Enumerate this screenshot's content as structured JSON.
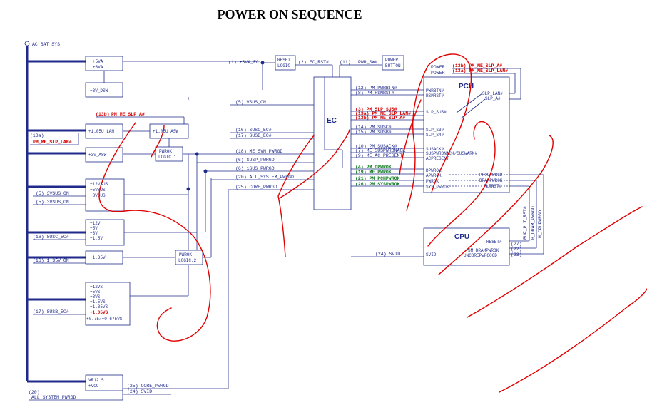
{
  "title": "POWER ON SEQUENCE",
  "rail": "AC_BAT_SYS",
  "left_blocks": {
    "b1": [
      "+5VA",
      "+3VA"
    ],
    "b1b": "+3V_DSW",
    "b2": "+1.05U_LAN",
    "b3": "+1.05U_ASW",
    "b4": "+3V_ASW",
    "pwrok1": [
      "PWROK",
      "LOGIC.1"
    ],
    "b5": [
      "+12VSUS",
      "+5VSUS",
      "+3VSUS"
    ],
    "b6": [
      "+12V",
      "+5V",
      "+3V",
      "+1.5V"
    ],
    "b7": "+1.35V",
    "pwrok2": [
      "PWROK",
      "LOGIC.2"
    ],
    "b8": [
      "+12VS",
      "+5VS",
      "+3VS",
      "+1.5VS",
      "+1.35VS"
    ],
    "b8_red": "+1.05VS",
    "b8_last": "+0.75/+0.675VS",
    "vr": [
      "VR12.5",
      "+VCC"
    ]
  },
  "left_signals": {
    "s13b": "(13b)",
    "s13b_name": "PM_ME_SLP_A#",
    "s13a": "(13a)",
    "s13a_name": "PM_ME_SLP_LAN#",
    "s5a": "(5) 3VSUS_ON",
    "s5b": "(5) 3VSUS_ON",
    "s16a": "(16) SUSC_EC#",
    "s16b": "(16) 1.35V_ON",
    "s17": "(17) SUSB_EC#",
    "s20": "(20)",
    "s20_name": "ALL_SYSTEM_PWRGD",
    "s25": "(25) CORE_PWRGD",
    "s24": "(24) SVID"
  },
  "top": {
    "s1": "(1) +3VA_EC",
    "reset": [
      "RESET",
      "LOGIC"
    ],
    "s2": "(2) EC_RST#",
    "s11": "(11)",
    "pwr_sw": "PWR_SW#",
    "button": [
      "POWER",
      "BUTTON"
    ]
  },
  "ec": {
    "title": "EC",
    "left_signals": [
      "(5) VSUS_ON",
      "(16) SUSC_EC#",
      "(17) SUSB_EC#",
      "(18) ME_SVM_PWRGD",
      "(6) SUSP_PWRGD",
      "(6) 1SUS_PWRGD",
      "(20) ALL_SYSTEM_PWRGD",
      "(25) CORE_PWRGD"
    ]
  },
  "ec_pch": [
    {
      "text": "(12) PM_PWRBTN#",
      "color": "blue"
    },
    {
      "text": "(8) PM_RSMRST#",
      "color": "blue"
    },
    {
      "text": "(3) PM_SLP_SUS#",
      "color": "red"
    },
    {
      "text": "(13a) PM_ME_SLP_LAN#",
      "color": "red"
    },
    {
      "text": "(13b) PM_ME_SLP_A#",
      "color": "red"
    },
    {
      "text": "(14) PM_SUSC#",
      "color": "blue"
    },
    {
      "text": "(15) PM_SUSB#",
      "color": "blue"
    },
    {
      "text": "(10) PM_SUSACK#",
      "color": "blue"
    },
    {
      "text": "(7) ME_SUSPWRDNACK",
      "color": "blue"
    },
    {
      "text": "(9) ME_AC_PRESENT",
      "color": "blue"
    },
    {
      "text": "(4) PM_DPWROK",
      "color": "green"
    },
    {
      "text": "(19) MF_PWROK",
      "color": "green"
    },
    {
      "text": "(21) PM_PCHPWROK",
      "color": "green"
    },
    {
      "text": "(26) PM_SYSPWROK",
      "color": "green"
    }
  ],
  "pch": {
    "title": "PCH",
    "power1": "POWER",
    "power2": "POWER",
    "top13b": "(13b) PM_ME_SLP_A#",
    "top13a": "(13a) PM_ME_SLP_LAN#",
    "pins_left": [
      "PWRBTN#",
      "RSMRST#",
      "SLP_SUS#",
      "SLP_S3#",
      "SLP_S4#",
      "SUSACK#",
      "SUSPWRDNACK/SUSWARN#",
      "ACPRESENT",
      "DPWROK",
      "APWROK",
      "PWROK",
      "SYS_PWROK"
    ],
    "pins_right": [
      "SLP_LAN#",
      "SLP_A#",
      "PROCPWRGD",
      "DRAMPWROK",
      "PLTRST#"
    ]
  },
  "cpu": {
    "title": "CPU",
    "reset": "RESET#",
    "svid": "SVID",
    "p1": "SM_DRAMPWROK",
    "p2": "UNCOREPWRGOOD",
    "n27": "(27)",
    "n22": "(22)",
    "n23": "(23)",
    "svid_sig": "(24) SVID",
    "v1": "BUF_PLT_RST#",
    "v2": "H_DRAM_PWRGD",
    "v3": "H_CPUPWRGD"
  }
}
